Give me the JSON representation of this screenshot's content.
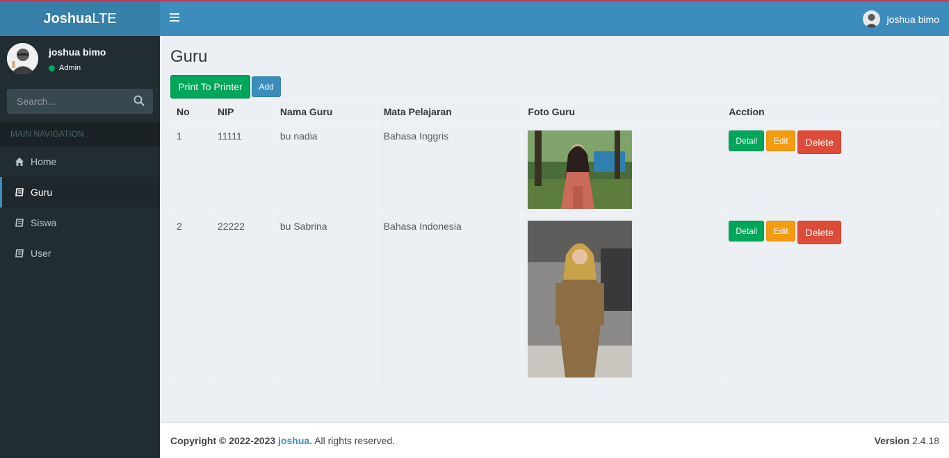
{
  "brand": {
    "bold": "Joshua",
    "light": "LTE"
  },
  "navbar": {
    "user_name": "joshua bimo"
  },
  "sidebar": {
    "user_name": "joshua bimo",
    "user_role": "Admin",
    "search_placeholder": "Search...",
    "header": "MAIN NAVIGATION",
    "items": [
      {
        "label": "Home",
        "icon": "home-icon"
      },
      {
        "label": "Guru",
        "icon": "book-icon",
        "active": true
      },
      {
        "label": "Siswa",
        "icon": "book-icon"
      },
      {
        "label": "User",
        "icon": "book-icon"
      }
    ]
  },
  "page": {
    "title": "Guru",
    "print_label": "Print To Printer",
    "add_label": "Add"
  },
  "table": {
    "headers": [
      "No",
      "NIP",
      "Nama Guru",
      "Mata Pelajaran",
      "Foto Guru",
      "Acction"
    ],
    "rows": [
      {
        "no": "1",
        "nip": "11111",
        "nama": "bu nadia",
        "mapel": "Bahasa Inggris"
      },
      {
        "no": "2",
        "nip": "22222",
        "nama": "bu Sabrina",
        "mapel": "Bahasa Indonesia"
      }
    ],
    "detail_label": "Detail",
    "edit_label": "Edit",
    "delete_label": "Delete"
  },
  "footer": {
    "copyright": "Copyright © 2022-2023",
    "link": "joshua.",
    "rights": "All rights reserved.",
    "version_label": "Version",
    "version": "2.4.18"
  },
  "colors": {
    "primary": "#3c8dbc",
    "success": "#00a65a",
    "warning": "#f39c12",
    "danger": "#dd4b39",
    "sidebar": "#222d32"
  }
}
